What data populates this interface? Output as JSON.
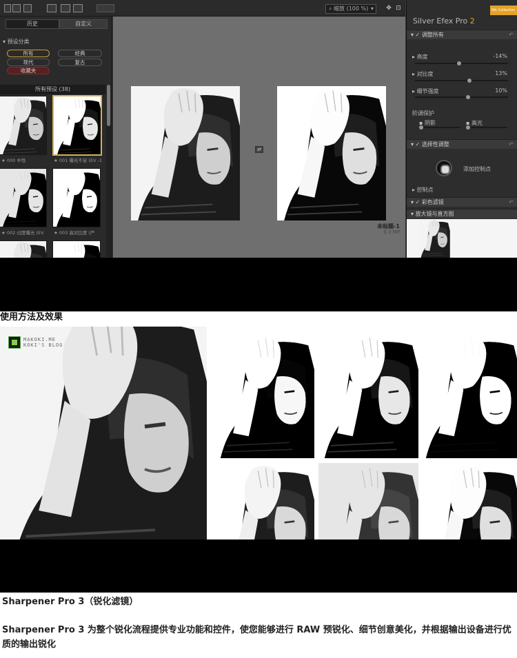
{
  "toolbar": {
    "zoom_label": "缩放 (100 %)",
    "zoom_chevron": "▾"
  },
  "left_panel": {
    "tabs": [
      "历史",
      "自定义"
    ],
    "section_title": "预设分类",
    "categories": [
      "所有",
      "经典",
      "现代",
      "复古",
      "收藏夹"
    ],
    "presets_header": "所有预设 (38)",
    "thumb_captions": [
      "★ 000 中性",
      "★ 001 曝光不足 (EV -1",
      "★ 002 过度曝光 (EV",
      "★ 003 高对比度 (严"
    ]
  },
  "canvas": {
    "doc_name": "未标题-1",
    "doc_size": "0.3 MP"
  },
  "right_panel": {
    "app_title": "Silver Efex Pro",
    "app_version": "2",
    "badge": "Nik Collection",
    "sections": {
      "global": "调整所有",
      "selective": "选择性调整",
      "color_filter": "彩色滤镜",
      "loupe": "放大镜与直方图"
    },
    "sliders": [
      {
        "label": "亮度",
        "value": "-14%",
        "level": 0.45
      },
      {
        "label": "对比度",
        "value": "13%",
        "level": 0.56
      },
      {
        "label": "细节强度",
        "value": "10%",
        "level": 0.55
      }
    ],
    "tonal_protect": "阶调保护",
    "shadows": "阴影",
    "highlights": "高光",
    "add_control_point": "添加控制点",
    "control_points": "控制点"
  },
  "article": {
    "subheading": "使用方法及效果",
    "watermark_line1": "MAKOKI.ME",
    "watermark_line2": "KOKI'S BLOG",
    "section_title": "Sharpener Pro 3（锐化滤镜）",
    "section_body": "Sharpener Pro 3 为整个锐化流程提供专业功能和控件，使您能够进行 RAW 预锐化、细节创意美化，并根据输出设备进行优质的输出锐化"
  }
}
